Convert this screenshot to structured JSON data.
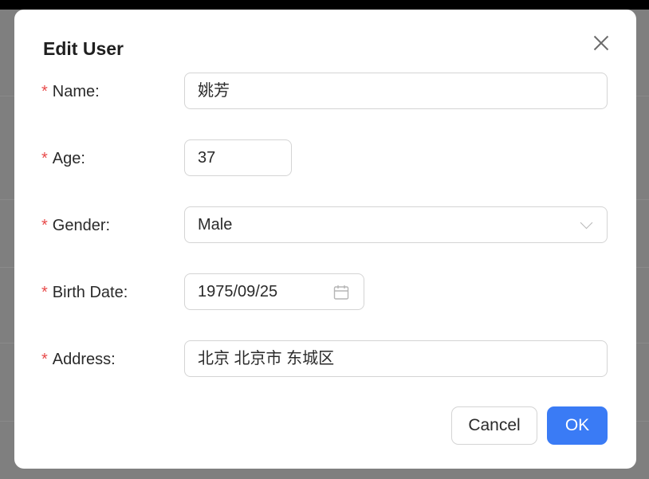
{
  "dialog": {
    "title": "Edit User",
    "required_mark": "*",
    "fields": {
      "name": {
        "label": "Name",
        "value": "姚芳"
      },
      "age": {
        "label": "Age",
        "value": "37"
      },
      "gender": {
        "label": "Gender",
        "value": "Male"
      },
      "birth_date": {
        "label": "Birth Date",
        "value": "1975/09/25"
      },
      "address": {
        "label": "Address",
        "value": "北京 北京市 东城区"
      }
    },
    "buttons": {
      "cancel": "Cancel",
      "ok": "OK"
    }
  },
  "colors": {
    "primary": "#3a7bf5",
    "required": "#e84a4a",
    "overlay": "#7f7f7f"
  }
}
